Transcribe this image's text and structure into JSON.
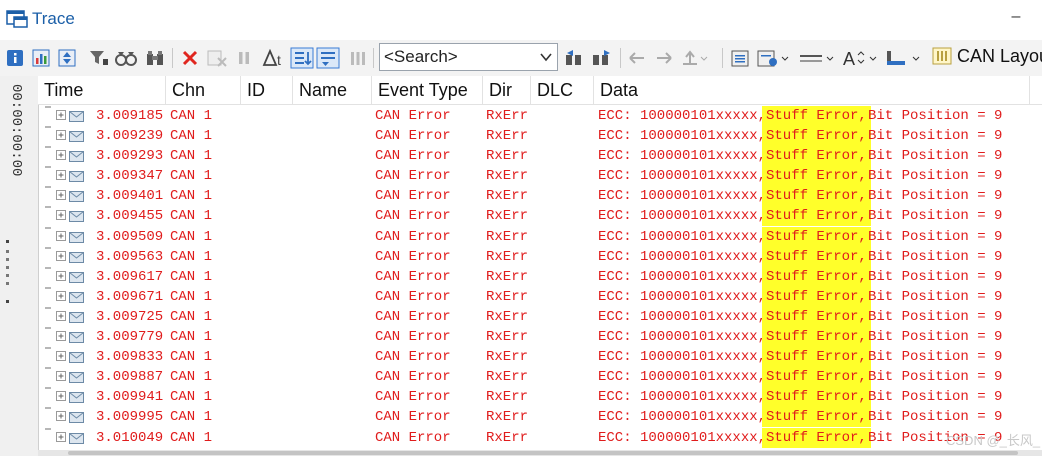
{
  "window": {
    "title": "Trace",
    "minimize_label": "–"
  },
  "toolbar": {
    "search_placeholder": "<Search>",
    "can_layout_label": "CAN Layou"
  },
  "left_panel": {
    "time_label": "00:00:00:00"
  },
  "columns": [
    {
      "key": "time",
      "label": "Time"
    },
    {
      "key": "chn",
      "label": "Chn"
    },
    {
      "key": "id",
      "label": "ID"
    },
    {
      "key": "name",
      "label": "Name"
    },
    {
      "key": "event_type",
      "label": "Event Type"
    },
    {
      "key": "dir",
      "label": "Dir"
    },
    {
      "key": "dlc",
      "label": "DLC"
    },
    {
      "key": "data",
      "label": "Data"
    }
  ],
  "rows": [
    {
      "time": "3.009185",
      "chn": "CAN 1",
      "event_type": "CAN Error",
      "dir": "RxErr",
      "ecc": "ECC: 100000101xxxxx,",
      "error": "Stuff Error,",
      "bitpos": "Bit Position = 9"
    },
    {
      "time": "3.009239",
      "chn": "CAN 1",
      "event_type": "CAN Error",
      "dir": "RxErr",
      "ecc": "ECC: 100000101xxxxx,",
      "error": "Stuff Error,",
      "bitpos": "Bit Position = 9"
    },
    {
      "time": "3.009293",
      "chn": "CAN 1",
      "event_type": "CAN Error",
      "dir": "RxErr",
      "ecc": "ECC: 100000101xxxxx,",
      "error": "Stuff Error,",
      "bitpos": "Bit Position = 9"
    },
    {
      "time": "3.009347",
      "chn": "CAN 1",
      "event_type": "CAN Error",
      "dir": "RxErr",
      "ecc": "ECC: 100000101xxxxx,",
      "error": "Stuff Error,",
      "bitpos": "Bit Position = 9"
    },
    {
      "time": "3.009401",
      "chn": "CAN 1",
      "event_type": "CAN Error",
      "dir": "RxErr",
      "ecc": "ECC: 100000101xxxxx,",
      "error": "Stuff Error,",
      "bitpos": "Bit Position = 9"
    },
    {
      "time": "3.009455",
      "chn": "CAN 1",
      "event_type": "CAN Error",
      "dir": "RxErr",
      "ecc": "ECC: 100000101xxxxx,",
      "error": "Stuff Error,",
      "bitpos": "Bit Position = 9"
    },
    {
      "time": "3.009509",
      "chn": "CAN 1",
      "event_type": "CAN Error",
      "dir": "RxErr",
      "ecc": "ECC: 100000101xxxxx,",
      "error": "Stuff Error,",
      "bitpos": "Bit Position = 9"
    },
    {
      "time": "3.009563",
      "chn": "CAN 1",
      "event_type": "CAN Error",
      "dir": "RxErr",
      "ecc": "ECC: 100000101xxxxx,",
      "error": "Stuff Error,",
      "bitpos": "Bit Position = 9"
    },
    {
      "time": "3.009617",
      "chn": "CAN 1",
      "event_type": "CAN Error",
      "dir": "RxErr",
      "ecc": "ECC: 100000101xxxxx,",
      "error": "Stuff Error,",
      "bitpos": "Bit Position = 9"
    },
    {
      "time": "3.009671",
      "chn": "CAN 1",
      "event_type": "CAN Error",
      "dir": "RxErr",
      "ecc": "ECC: 100000101xxxxx,",
      "error": "Stuff Error,",
      "bitpos": "Bit Position = 9"
    },
    {
      "time": "3.009725",
      "chn": "CAN 1",
      "event_type": "CAN Error",
      "dir": "RxErr",
      "ecc": "ECC: 100000101xxxxx,",
      "error": "Stuff Error,",
      "bitpos": "Bit Position = 9"
    },
    {
      "time": "3.009779",
      "chn": "CAN 1",
      "event_type": "CAN Error",
      "dir": "RxErr",
      "ecc": "ECC: 100000101xxxxx,",
      "error": "Stuff Error,",
      "bitpos": "Bit Position = 9"
    },
    {
      "time": "3.009833",
      "chn": "CAN 1",
      "event_type": "CAN Error",
      "dir": "RxErr",
      "ecc": "ECC: 100000101xxxxx,",
      "error": "Stuff Error,",
      "bitpos": "Bit Position = 9"
    },
    {
      "time": "3.009887",
      "chn": "CAN 1",
      "event_type": "CAN Error",
      "dir": "RxErr",
      "ecc": "ECC: 100000101xxxxx,",
      "error": "Stuff Error,",
      "bitpos": "Bit Position = 9"
    },
    {
      "time": "3.009941",
      "chn": "CAN 1",
      "event_type": "CAN Error",
      "dir": "RxErr",
      "ecc": "ECC: 100000101xxxxx,",
      "error": "Stuff Error,",
      "bitpos": "Bit Position = 9"
    },
    {
      "time": "3.009995",
      "chn": "CAN 1",
      "event_type": "CAN Error",
      "dir": "RxErr",
      "ecc": "ECC: 100000101xxxxx,",
      "error": "Stuff Error,",
      "bitpos": "Bit Position = 9"
    },
    {
      "time": "3.010049",
      "chn": "CAN 1",
      "event_type": "CAN Error",
      "dir": "RxErr",
      "ecc": "ECC: 100000101xxxxx,",
      "error": "Stuff Error,",
      "bitpos": "Bit Position = 9"
    }
  ],
  "watermark": "CSDN @_长风_",
  "colors": {
    "error_text": "#e01c1c",
    "highlight": "#ffff2a",
    "title_blue": "#1b5fa8"
  }
}
